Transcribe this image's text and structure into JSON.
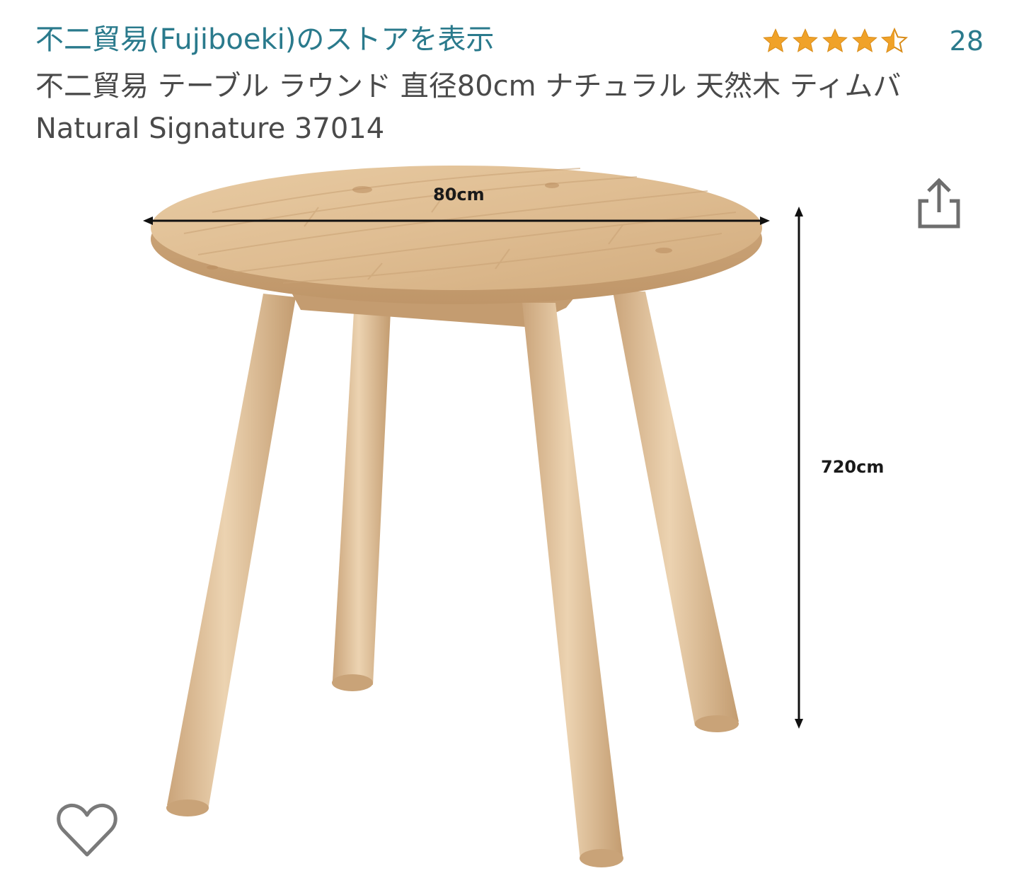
{
  "header": {
    "store_link": "不二貿易(Fujiboeki)のストアを表示",
    "rating": {
      "stars": 4.5,
      "count": "28",
      "star_color": "#f0a229",
      "icon": "star-icon"
    },
    "product_title": "不二貿易 テーブル ラウンド 直径80cm ナチュラル 天然木 ティムバ Natural Signature 37014"
  },
  "image": {
    "width_label": "80cm",
    "height_label": "720cm"
  },
  "actions": {
    "share_icon": "share-icon",
    "favorite_icon": "heart-icon"
  },
  "colors": {
    "link": "#2a7a8c",
    "wood": "#dbb98d",
    "icon_gray": "#6e6e6e"
  }
}
